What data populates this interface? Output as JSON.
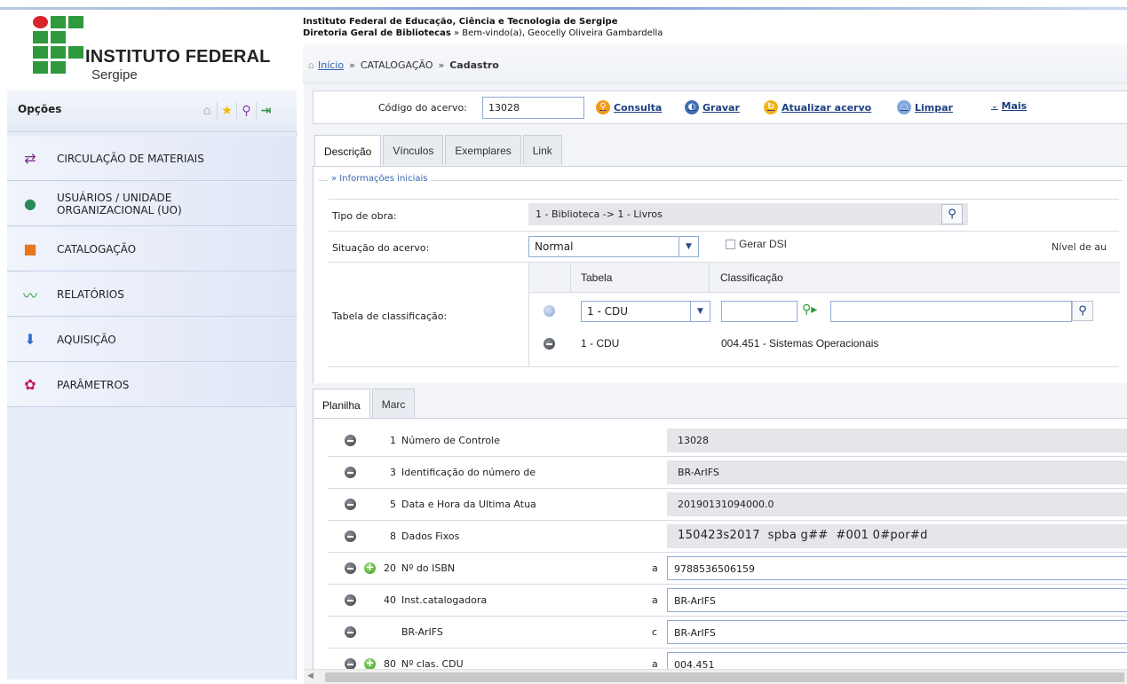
{
  "header": {
    "logo_title": "INSTITUTO FEDERAL",
    "logo_sub": "Sergipe",
    "institution": "Instituto Federal de Educação, Ciência e Tecnologia de Sergipe",
    "directorate": "Diretoria Geral de Bibliotecas",
    "welcome": " » Bem-vindo(a), Geocelly Oliveira Gambardella",
    "breadcrumb": {
      "home": "Início",
      "section": "CATALOGAÇÃO",
      "current": "Cadastro",
      "separator": "»"
    }
  },
  "sidebar": {
    "title": "Opções",
    "items": [
      {
        "label": "CIRCULAÇÃO DE MATERIAIS",
        "icon": "circulation-icon"
      },
      {
        "label": "USUÁRIOS / UNIDADE ORGANIZACIONAL (UO)",
        "icon": "users-icon"
      },
      {
        "label": "CATALOGAÇÃO",
        "icon": "cataloging-icon"
      },
      {
        "label": "RELATÓRIOS",
        "icon": "reports-icon"
      },
      {
        "label": "AQUISIÇÃO",
        "icon": "acquisition-icon"
      },
      {
        "label": "PARÂMETROS",
        "icon": "parameters-icon"
      }
    ]
  },
  "toolbar": {
    "acervo_label": "Código do acervo:",
    "acervo_value": "13028",
    "consulta": "Consulta",
    "gravar": "Gravar",
    "atualizar": "Atualizar acervo",
    "limpar": "Limpar",
    "mais": "Mais"
  },
  "tabs": [
    "Descrição",
    "Vínculos",
    "Exemplares",
    "Link"
  ],
  "info": {
    "legend": "» Informações iniciais",
    "tipo_label": "Tipo de obra:",
    "tipo_value": "1 - Biblioteca -> 1 - Livros",
    "situacao_label": "Situação do acervo:",
    "situacao_value": "Normal",
    "gerar_dsi": "Gerar DSI",
    "nivel": "Nível de au",
    "classificacao_label": "Tabela de classificação:",
    "col_tabela": "Tabela",
    "col_classificacao": "Classificação",
    "select_tabela": "1 - CDU",
    "row_tabela": "1 - CDU",
    "row_classificacao": "004.451 - Sistemas Operacionais"
  },
  "tabs2": [
    "Planilha",
    "Marc"
  ],
  "marc": [
    {
      "num": "1",
      "name": "Número de Controle",
      "sub": "",
      "value": "13028",
      "editable": false
    },
    {
      "num": "3",
      "name": "Identificação do número de",
      "sub": "",
      "value": "BR-ArIFS",
      "editable": false
    },
    {
      "num": "5",
      "name": "Data e Hora da Ultima Atua",
      "sub": "",
      "value": "20190131094000.0",
      "editable": false
    },
    {
      "num": "8",
      "name": "Dados Fixos",
      "sub": "",
      "value": "150423s2017  spba g##  #001 0#por#d",
      "editable": false
    },
    {
      "num": "20",
      "name": "Nº do ISBN",
      "sub": "a",
      "value": "9788536506159",
      "editable": true
    },
    {
      "num": "40",
      "name": "Inst.catalogadora",
      "sub": "a",
      "value": "BR-ArIFS",
      "editable": true
    },
    {
      "num": "",
      "name": "BR-ArIFS",
      "sub": "c",
      "value": "BR-ArIFS",
      "editable": true
    },
    {
      "num": "80",
      "name": "Nº clas. CDU",
      "sub": "a",
      "value": "004.451",
      "editable": true
    }
  ],
  "colors": {
    "accent": "#1d3f80",
    "sidebar_bg": "#e8eef9",
    "logo_green": "#2e9a3c",
    "logo_red": "#d8232a"
  }
}
